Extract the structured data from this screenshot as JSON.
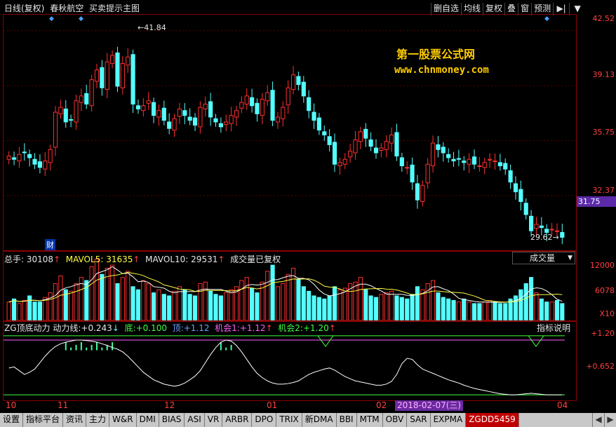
{
  "header": {
    "chart_mode": "日线(复权)",
    "stock_name": "春秋航空",
    "formula": "买卖提示主图",
    "buttons": [
      "删自选",
      "均线",
      "复权",
      "叠",
      "窗",
      "预测"
    ],
    "ico_play": "▶|",
    "ico_menu": "▼"
  },
  "price_axis": [
    "42.52",
    "39.13",
    "35.75",
    "32.37",
    "31.75"
  ],
  "price_labels": {
    "high": "←41.84",
    "low": "29.62→",
    "cai": "财",
    "current": "31.75"
  },
  "watermark": {
    "line1": "第一股票公式网",
    "line2": "www.chnmoney.com"
  },
  "volume_header": {
    "total_label": "总手:",
    "total_value": "30108",
    "total_arrow": "↑",
    "ma5_label": "MAVOL5:",
    "ma5_value": "31635",
    "ma5_arrow": "↑",
    "ma10_label": "MAVOL10:",
    "ma10_value": "29531",
    "ma10_arrow": "↑",
    "note": "成交量已复权"
  },
  "volume_select": "成交量",
  "volume_axis": [
    "12000",
    "6078",
    "X10"
  ],
  "indicator_header": {
    "name": "ZG顶底动力",
    "line_label": "动力线:",
    "line_value": "+0.243",
    "line_arrow": "↓",
    "bottom_label": "底:",
    "bottom_value": "+0.100",
    "top_label": "顶:",
    "top_value": "+1.12",
    "chance1_label": "机会1:",
    "chance1_value": "+1.12",
    "chance1_arrow": "↑",
    "chance2_label": "机会2:",
    "chance2_value": "+1.20",
    "chance2_arrow": "↑"
  },
  "indicator_help": "指标说明",
  "indicator_axis": [
    "+1.20",
    "+0.652"
  ],
  "x_axis": [
    "10",
    "11",
    "12",
    "01",
    "02",
    "3",
    "04"
  ],
  "date_badge": "2018-02-07(三)",
  "tabs": [
    "设置",
    "指标平台",
    "资讯",
    "主力",
    "W&R",
    "DMI",
    "BIAS",
    "ASI",
    "VR",
    "ARBR",
    "DPO",
    "TRIX",
    "新DMA",
    "BBI",
    "MTM",
    "OBV",
    "SAR",
    "EXPMA",
    "ZGDD5459"
  ],
  "tab_nav": [
    "◀",
    "▶"
  ],
  "colors": {
    "up": "#ff3030",
    "down": "#54ffff",
    "panel_border": "#8a0000",
    "active_tab": "#c00000"
  },
  "chart_data": {
    "type": "candlestick",
    "title": "",
    "ylim": [
      29.0,
      43.5
    ],
    "closes": [
      34.8,
      34.6,
      34.9,
      35.0,
      34.7,
      34.3,
      34.1,
      34.5,
      35.2,
      37.5,
      37.8,
      36.9,
      37.0,
      38.2,
      38.5,
      38.0,
      39.5,
      40.1,
      39.0,
      40.6,
      41.0,
      39.1,
      40.5,
      40.9,
      38.0,
      37.7,
      37.9,
      38.2,
      37.3,
      37.6,
      37.0,
      36.5,
      37.1,
      37.7,
      37.3,
      37.0,
      36.7,
      37.8,
      38.0,
      37.2,
      36.9,
      36.6,
      36.9,
      37.3,
      37.6,
      38.1,
      38.5,
      37.9,
      37.4,
      38.3,
      38.7,
      37.0,
      37.2,
      37.8,
      39.0,
      39.8,
      39.2,
      38.5,
      37.6,
      37.0,
      36.4,
      36.1,
      35.5,
      34.3,
      34.4,
      34.6,
      35.1,
      35.8,
      36.3,
      35.9,
      35.4,
      35.0,
      35.3,
      35.7,
      36.1,
      34.8,
      34.2,
      34.1,
      33.2,
      32.1,
      33.0,
      34.3,
      35.6,
      35.2,
      35.0,
      34.7,
      34.5,
      34.6,
      34.4,
      34.6,
      34.3,
      34.2,
      34.4,
      34.6,
      34.5,
      34.2,
      34.0,
      33.2,
      32.6,
      32.0,
      31.2,
      30.2,
      30.6,
      30.4,
      30.1,
      30.3,
      30.2,
      29.8
    ]
  },
  "volume_data": [
    12,
    14,
    11,
    13,
    16,
    12,
    12,
    15,
    18,
    24,
    29,
    20,
    19,
    24,
    28,
    26,
    35,
    40,
    30,
    34,
    36,
    24,
    28,
    32,
    22,
    20,
    26,
    24,
    18,
    20,
    17,
    16,
    19,
    22,
    20,
    17,
    16,
    24,
    25,
    19,
    17,
    16,
    18,
    20,
    22,
    26,
    28,
    21,
    18,
    25,
    32,
    36,
    22,
    24,
    30,
    34,
    27,
    22,
    19,
    16,
    15,
    14,
    16,
    22,
    20,
    21,
    24,
    25,
    28,
    20,
    16,
    15,
    17,
    18,
    19,
    16,
    15,
    14,
    17,
    22,
    20,
    24,
    26,
    18,
    15,
    14,
    13,
    12,
    14,
    12,
    11,
    11,
    12,
    13,
    12,
    11,
    11,
    14,
    16,
    20,
    24,
    28,
    18,
    14,
    12,
    12,
    13,
    11
  ],
  "indicator_data": [
    0.6,
    0.62,
    0.55,
    0.48,
    0.52,
    0.58,
    0.7,
    0.82,
    0.92,
    1.0,
    1.05,
    1.08,
    1.1,
    1.12,
    1.12,
    1.11,
    1.1,
    1.08,
    1.05,
    1.02,
    0.98,
    0.95,
    0.9,
    0.82,
    0.72,
    0.62,
    0.52,
    0.45,
    0.38,
    0.34,
    0.3,
    0.28,
    0.26,
    0.28,
    0.32,
    0.38,
    0.45,
    0.55,
    0.7,
    0.85,
    0.98,
    1.08,
    1.12,
    1.1,
    1.02,
    0.9,
    0.76,
    0.62,
    0.5,
    0.42,
    0.36,
    0.32,
    0.3,
    0.3,
    0.31,
    0.33,
    0.36,
    0.42,
    0.48,
    0.52,
    0.55,
    0.58,
    0.6,
    0.56,
    0.5,
    0.44,
    0.4,
    0.36,
    0.34,
    0.32,
    0.3,
    0.28,
    0.28,
    0.3,
    0.35,
    0.48,
    0.68,
    0.78,
    0.76,
    0.66,
    0.58,
    0.54,
    0.5,
    0.46,
    0.42,
    0.38,
    0.35,
    0.32,
    0.28,
    0.25,
    0.22,
    0.2,
    0.18,
    0.16,
    0.14,
    0.12,
    0.11,
    0.1,
    0.1,
    0.11,
    0.12,
    0.13,
    0.12,
    0.11,
    0.1,
    0.1,
    0.1,
    0.1
  ]
}
